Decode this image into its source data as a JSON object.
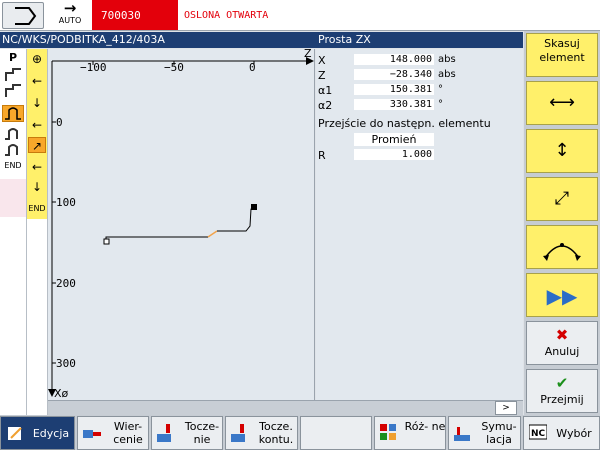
{
  "topbar": {
    "mode_label": "AUTO",
    "alarm_number": "700030",
    "alarm_text": "OSLONA OTWARTA"
  },
  "header": {
    "path": "NC/WKS/PODBITKA_412/403A",
    "panel_title": "Prosta  ZX"
  },
  "left_column": {
    "p_label": "P",
    "end_label": "END"
  },
  "element_column": {
    "end_label": "END"
  },
  "graphic": {
    "z_axis_label": "Z",
    "x_axis_label": "Xø",
    "z_ticks": [
      "−100",
      "−50",
      "0"
    ],
    "x_ticks": [
      "0",
      "100",
      "200",
      "300"
    ]
  },
  "params": {
    "x": {
      "name": "X",
      "value": "148.000",
      "unit": "abs"
    },
    "z": {
      "name": "Z",
      "value": "−28.340",
      "unit": "abs"
    },
    "a1": {
      "name": "α1",
      "value": "150.381",
      "unit": "°"
    },
    "a2": {
      "name": "α2",
      "value": "330.381",
      "unit": "°"
    },
    "transition": "Przejście do następn. elementu",
    "transition_value": "Promień",
    "r": {
      "name": "R",
      "value": "1.000"
    }
  },
  "softkeys": {
    "delete_element": "Skasuj element",
    "cancel": "Anuluj",
    "accept": "Przejmij"
  },
  "scroll_arrow": ">",
  "bottom": {
    "edit": "Edycja",
    "drill": "Wier- cenie",
    "turning": "Tocze- nie",
    "contour_turning": "Tocze. kontu.",
    "misc": "Róż- ne",
    "simulation": "Symu- lacja",
    "select": "Wybór"
  },
  "colors": {
    "header_blue": "#1d3e73",
    "softkey_yellow": "#fff06a",
    "alarm_red": "#e3000b",
    "selection_orange": "#f8a72a"
  }
}
